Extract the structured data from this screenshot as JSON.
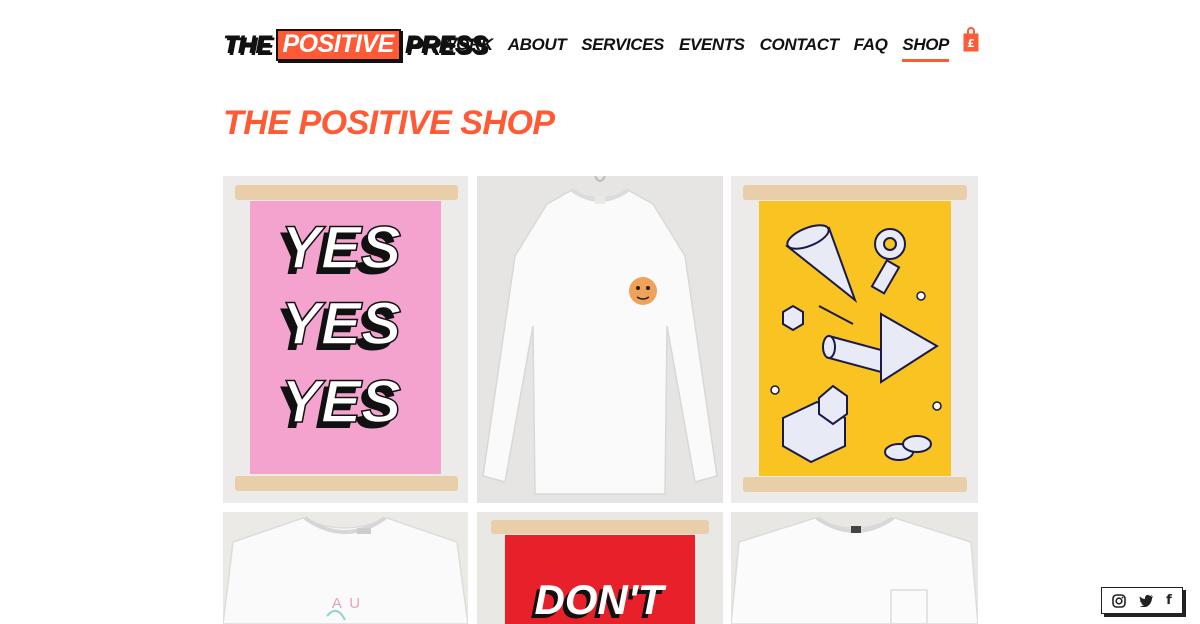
{
  "brand": {
    "logo_word_1": "THE",
    "logo_word_2": "POSITIVE",
    "logo_word_3": "PRESS"
  },
  "nav": {
    "items": [
      {
        "label": "WORK"
      },
      {
        "label": "ABOUT"
      },
      {
        "label": "SERVICES"
      },
      {
        "label": "EVENTS"
      },
      {
        "label": "CONTACT"
      },
      {
        "label": "FAQ"
      },
      {
        "label": "SHOP"
      }
    ],
    "active": "SHOP",
    "bag_symbol": "£"
  },
  "page": {
    "title": "THE POSITIVE SHOP"
  },
  "products": [
    {
      "image": "print-yes-yes-yes",
      "poster_lines": [
        "YES",
        "YES",
        "YES"
      ]
    },
    {
      "image": "white-longsleeve-tshirt-face-patch"
    },
    {
      "image": "print-yellow-3d-shapes"
    },
    {
      "image": "white-tshirt-au-print",
      "visible_text": "A   U"
    },
    {
      "image": "print-dont-red",
      "poster_text": "DON'T"
    },
    {
      "image": "white-tshirt-pocket"
    }
  ],
  "social": {
    "icons": [
      "instagram-icon",
      "twitter-icon",
      "facebook-icon"
    ],
    "facebook_glyph": "f"
  },
  "colors": {
    "accent": "#ff5a36",
    "text": "#111111",
    "poster_pink": "#f4a3cf",
    "poster_yellow": "#f9c322",
    "poster_red": "#e8202a"
  }
}
